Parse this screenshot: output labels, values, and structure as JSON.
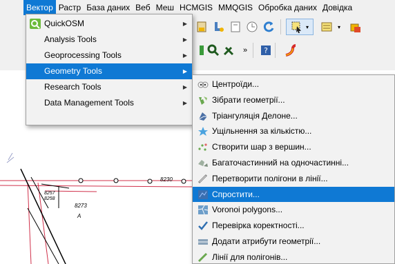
{
  "menubar": {
    "items": [
      "Вектор",
      "Растр",
      "База даних",
      "Веб",
      "Меш",
      "HCMGIS",
      "MMQGIS",
      "Обробка даних",
      "Довідка"
    ],
    "active": "Вектор"
  },
  "vector_menu": {
    "items": [
      {
        "label": "QuickOSM",
        "icon": "quickosm-icon",
        "submenu": true
      },
      {
        "label": "Analysis Tools",
        "submenu": true
      },
      {
        "label": "Geoprocessing Tools",
        "submenu": true
      },
      {
        "label": "Geometry Tools",
        "submenu": true,
        "highlighted": true
      },
      {
        "label": "Research Tools",
        "submenu": true
      },
      {
        "label": "Data Management Tools",
        "submenu": true
      }
    ]
  },
  "geometry_menu": {
    "items": [
      {
        "label": "Центроїди...",
        "icon": "centroids-icon"
      },
      {
        "label": "Зібрати геометрії...",
        "icon": "collect-geometries-icon"
      },
      {
        "label": "Тріангуляція Делоне...",
        "icon": "delaunay-icon"
      },
      {
        "label": "Ущільнення за кількістю...",
        "icon": "densify-icon"
      },
      {
        "label": "Створити шар з вершин...",
        "icon": "extract-vertices-icon"
      },
      {
        "label": "Багаточастинний на одночастинні...",
        "icon": "multipart-to-single-icon"
      },
      {
        "label": "Перетворити полігони в лінії...",
        "icon": "polygons-to-lines-icon"
      },
      {
        "label": "Спростити...",
        "icon": "simplify-icon",
        "highlighted": true
      },
      {
        "label": "Voronoi polygons...",
        "icon": "voronoi-icon"
      },
      {
        "label": "Перевірка коректності...",
        "icon": "check-validity-icon"
      },
      {
        "label": "Додати атрибути геометрії...",
        "icon": "add-geometry-attributes-icon"
      },
      {
        "label": "Лінії для полігонів...",
        "icon": "lines-to-polygons-icon"
      }
    ]
  },
  "map_labels": {
    "l1": "8230",
    "l2": "8257",
    "l3": "8258",
    "l4": "8273",
    "l5": "A"
  },
  "colors": {
    "highlight": "#0f79d4",
    "menu_bg": "#f2f2f2",
    "map_line_red": "#d0304a"
  }
}
